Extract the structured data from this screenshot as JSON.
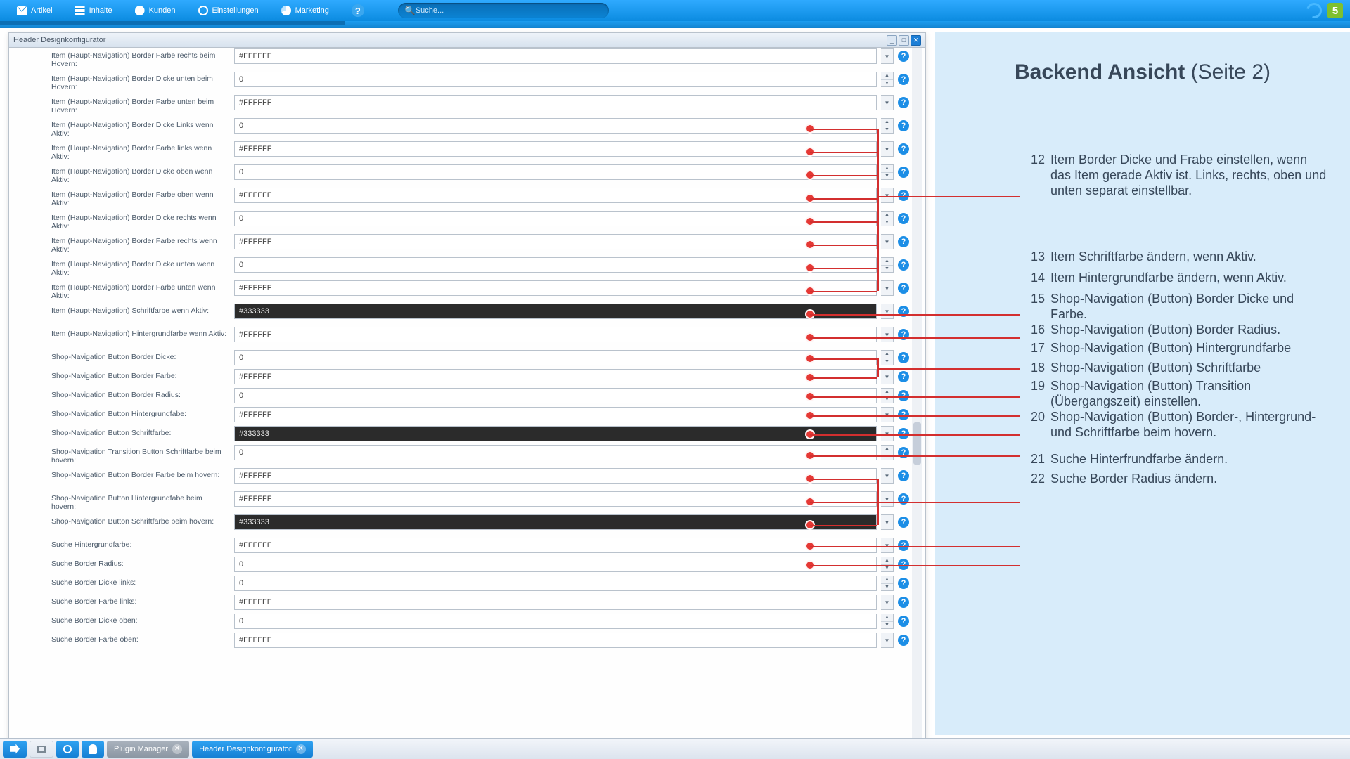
{
  "menu": [
    "Artikel",
    "Inhalte",
    "Kunden",
    "Einstellungen",
    "Marketing"
  ],
  "search_placeholder": "Suche...",
  "panel_title": "Header Designkonfigurator",
  "info_title_bold": "Backend Ansicht",
  "info_title_rest": " (Seite 2)",
  "notes": [
    {
      "n": "12",
      "t": "Item Border Dicke und Frabe einstellen, wenn das Item gerade Aktiv ist. Links, rechts, oben und unten separat einstellbar."
    },
    {
      "n": "13",
      "t": "Item Schriftfarbe ändern, wenn Aktiv."
    },
    {
      "n": "14",
      "t": "Item Hintergrundfarbe ändern, wenn Aktiv."
    },
    {
      "n": "15",
      "t": "Shop-Navigation (Button) Border Dicke und Farbe."
    },
    {
      "n": "16",
      "t": "Shop-Navigation (Button) Border Radius."
    },
    {
      "n": "17",
      "t": "Shop-Navigation (Button) Hintergrundfarbe"
    },
    {
      "n": "18",
      "t": "Shop-Navigation (Button) Schriftfarbe"
    },
    {
      "n": "19",
      "t": "Shop-Navigation (Button) Transition (Übergangszeit) einstellen."
    },
    {
      "n": "20",
      "t": "Shop-Navigation (Button) Border-, Hintergrund- und Schriftfarbe beim hovern."
    },
    {
      "n": "21",
      "t": "Suche Hinterfrundfarbe ändern."
    },
    {
      "n": "22",
      "t": "Suche Border Radius ändern."
    }
  ],
  "rows": [
    {
      "label": "Item (Haupt-Navigation) Border Farbe rechts beim Hovern:",
      "value": "#FFFFFF",
      "type": "color",
      "tall": true
    },
    {
      "label": "Item (Haupt-Navigation) Border Dicke unten beim Hovern:",
      "value": "0",
      "type": "num",
      "tall": true
    },
    {
      "label": "Item (Haupt-Navigation) Border Farbe unten beim Hovern:",
      "value": "#FFFFFF",
      "type": "color",
      "tall": true
    },
    {
      "label": "Item (Haupt-Navigation) Border Dicke Links wenn Aktiv:",
      "value": "0",
      "type": "num",
      "tall": true
    },
    {
      "label": "Item (Haupt-Navigation) Border Farbe links wenn Aktiv:",
      "value": "#FFFFFF",
      "type": "color",
      "tall": true
    },
    {
      "label": "Item (Haupt-Navigation) Border Dicke oben wenn Aktiv:",
      "value": "0",
      "type": "num",
      "tall": true
    },
    {
      "label": "Item (Haupt-Navigation) Border Farbe oben wenn Aktiv:",
      "value": "#FFFFFF",
      "type": "color",
      "tall": true
    },
    {
      "label": "Item (Haupt-Navigation) Border Dicke rechts wenn Aktiv:",
      "value": "0",
      "type": "num",
      "tall": true
    },
    {
      "label": "Item (Haupt-Navigation) Border Farbe rechts wenn Aktiv:",
      "value": "#FFFFFF",
      "type": "color",
      "tall": true
    },
    {
      "label": "Item (Haupt-Navigation) Border Dicke unten wenn Aktiv:",
      "value": "0",
      "type": "num",
      "tall": true
    },
    {
      "label": "Item (Haupt-Navigation) Border Farbe unten wenn Aktiv:",
      "value": "#FFFFFF",
      "type": "color",
      "tall": true
    },
    {
      "label": "Item (Haupt-Navigation) Schriftfarbe wenn Aktiv:",
      "value": "#333333",
      "type": "color",
      "dark": true,
      "tall": true
    },
    {
      "label": "Item (Haupt-Navigation) Hintergrundfarbe wenn Aktiv:",
      "value": "#FFFFFF",
      "type": "color",
      "tall": true
    },
    {
      "label": "Shop-Navigation Button Border Dicke:",
      "value": "0",
      "type": "num"
    },
    {
      "label": "Shop-Navigation Button Border Farbe:",
      "value": "#FFFFFF",
      "type": "color"
    },
    {
      "label": "Shop-Navigation Button Border Radius:",
      "value": "0",
      "type": "num"
    },
    {
      "label": "Shop-Navigation Button Hintergrundfabe:",
      "value": "#FFFFFF",
      "type": "color"
    },
    {
      "label": "Shop-Navigation Button Schriftfarbe:",
      "value": "#333333",
      "type": "color",
      "dark": true
    },
    {
      "label": "Shop-Navigation Transition Button Schriftfarbe beim hovern:",
      "value": "0",
      "type": "num",
      "tall": true
    },
    {
      "label": "Shop-Navigation Button Border Farbe beim hovern:",
      "value": "#FFFFFF",
      "type": "color",
      "tall": true
    },
    {
      "label": "Shop-Navigation Button Hintergrundfabe beim hovern:",
      "value": "#FFFFFF",
      "type": "color",
      "tall": true
    },
    {
      "label": "Shop-Navigation Button Schriftfarbe beim hovern:",
      "value": "#333333",
      "type": "color",
      "dark": true,
      "tall": true
    },
    {
      "label": "Suche Hintergrundfarbe:",
      "value": "#FFFFFF",
      "type": "color"
    },
    {
      "label": "Suche Border Radius:",
      "value": "0",
      "type": "num"
    },
    {
      "label": "Suche Border Dicke links:",
      "value": "0",
      "type": "num"
    },
    {
      "label": "Suche Border Farbe links:",
      "value": "#FFFFFF",
      "type": "color"
    },
    {
      "label": "Suche Border Dicke oben:",
      "value": "0",
      "type": "num"
    },
    {
      "label": "Suche Border Farbe oben:",
      "value": "#FFFFFF",
      "type": "color"
    }
  ],
  "taskbar": {
    "plugin_manager": "Plugin Manager",
    "header_config": "Header Designkonfigurator"
  }
}
